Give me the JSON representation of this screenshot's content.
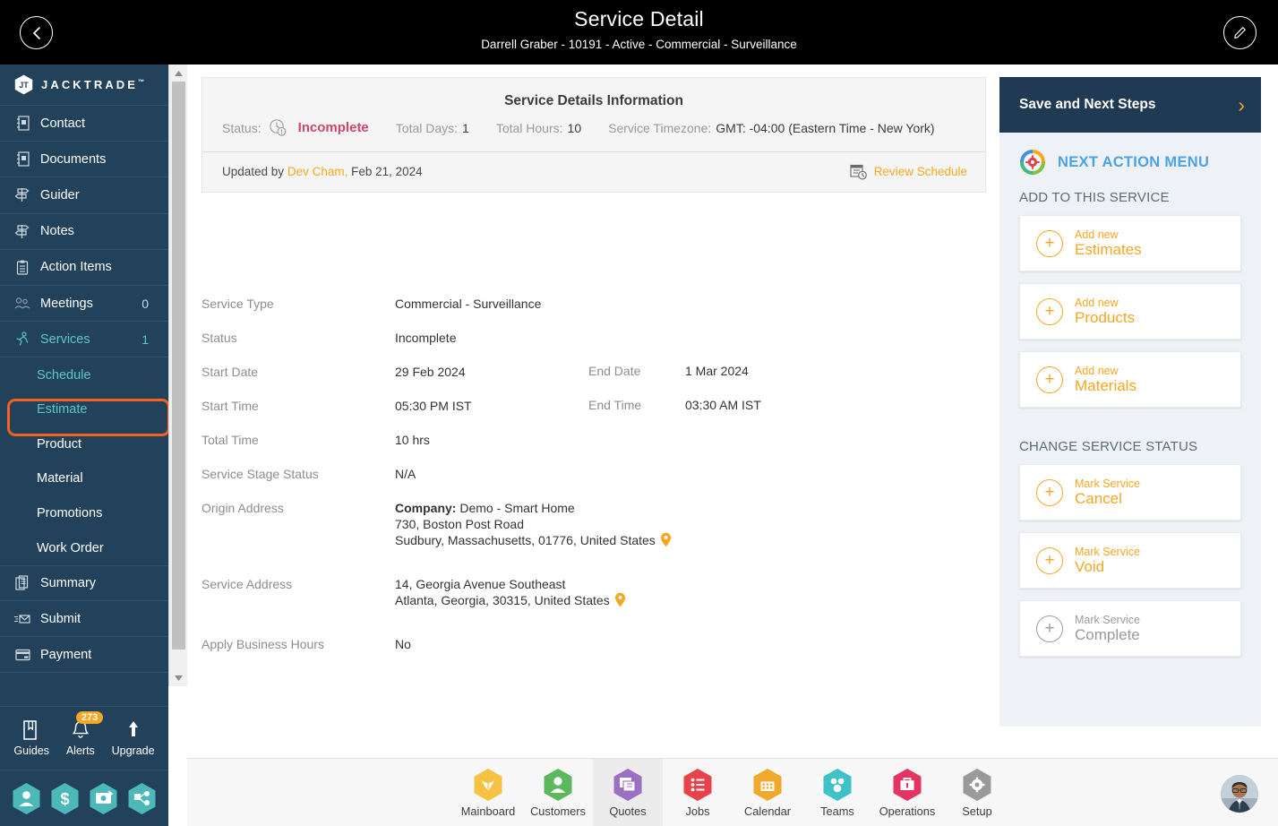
{
  "header": {
    "title": "Service Detail",
    "subtitle": "Darrell Graber - 10191 - Active - Commercial - Surveillance",
    "back_icon": "chevron-left-icon",
    "edit_icon": "pencil-icon"
  },
  "sidebar": {
    "brand": "JACKTRADE",
    "brand_tm": "™",
    "items": [
      {
        "label": "Contact",
        "icon": "contact-book-icon",
        "count": ""
      },
      {
        "label": "Documents",
        "icon": "documents-icon",
        "count": ""
      },
      {
        "label": "Guider",
        "icon": "guidepost-icon",
        "count": ""
      },
      {
        "label": "Notes",
        "icon": "guidepost-icon",
        "count": ""
      },
      {
        "label": "Action Items",
        "icon": "clipboard-icon",
        "count": ""
      },
      {
        "label": "Meetings",
        "icon": "meetings-icon",
        "count": "0"
      },
      {
        "label": "Services",
        "icon": "services-runner-icon",
        "count": "1"
      }
    ],
    "sub_items": [
      {
        "label": "Schedule",
        "state": "teal"
      },
      {
        "label": "Estimate",
        "state": "highlight"
      },
      {
        "label": "Product",
        "state": "normal"
      },
      {
        "label": "Material",
        "state": "normal"
      },
      {
        "label": "Promotions",
        "state": "normal"
      },
      {
        "label": "Work Order",
        "state": "normal"
      }
    ],
    "items_after": [
      {
        "label": "Summary",
        "icon": "summary-pages-icon",
        "count": ""
      },
      {
        "label": "Submit",
        "icon": "submit-envelope-icon",
        "count": ""
      },
      {
        "label": "Payment",
        "icon": "payment-card-icon",
        "count": ""
      }
    ],
    "bottom": [
      {
        "label": "Guides",
        "icon": "book-icon",
        "badge": ""
      },
      {
        "label": "Alerts",
        "icon": "bell-icon",
        "badge": "273"
      },
      {
        "label": "Upgrade",
        "icon": "up-arrow-icon",
        "badge": ""
      }
    ],
    "hex_buttons": [
      "user-hex-icon",
      "dollar-hex-icon",
      "money-transfer-hex-icon",
      "workflow-hex-icon"
    ],
    "highlight_color": "#f4621f"
  },
  "details_card": {
    "title": "Service Details Information",
    "status_label": "Status:",
    "status_icon": "clock-alert-icon",
    "status_value": "Incomplete",
    "total_days_label": "Total Days:",
    "total_days_value": "1",
    "total_hours_label": "Total Hours:",
    "total_hours_value": "10",
    "timezone_label": "Service Timezone:",
    "timezone_value": "GMT: -04:00 (Eastern Time - New York)",
    "updated_prefix": "Updated by",
    "updated_by": "Dev Cham,",
    "updated_date": "Feb 21, 2024",
    "review_schedule": "Review Schedule",
    "review_icon": "calendar-clock-icon"
  },
  "details": {
    "service_type_label": "Service Type",
    "service_type_value": "Commercial - Surveillance",
    "status_label": "Status",
    "status_value": "Incomplete",
    "start_date_label": "Start Date",
    "start_date_value": "29 Feb 2024",
    "end_date_label": "End Date",
    "end_date_value": "1 Mar 2024",
    "start_time_label": "Start Time",
    "start_time_value": "05:30 PM IST",
    "end_time_label": "End Time",
    "end_time_value": "03:30 AM IST",
    "total_time_label": "Total Time",
    "total_time_value": "10 hrs",
    "stage_status_label": "Service Stage Status",
    "stage_status_value": "N/A",
    "origin_address_label": "Origin Address",
    "origin_company_label": "Company:",
    "origin_company_value": "Demo - Smart Home",
    "origin_line2": "730, Boston Post Road",
    "origin_line3": "Sudbury, Massachusetts, 01776, United States",
    "service_address_label": "Service Address",
    "service_line1": "14, Georgia Avenue Southeast",
    "service_line2": "Atlanta, Georgia, 30315, United States",
    "business_hours_label": "Apply Business Hours",
    "business_hours_value": "No",
    "pin_icon": "map-pin-icon"
  },
  "right_panel": {
    "header_title": "Save and Next Steps",
    "header_chevron": "chevron-right-icon",
    "menu_icon": "refresh-gear-icon",
    "menu_title": "NEXT ACTION MENU",
    "section1_label": "ADD TO THIS SERVICE",
    "section1_items": [
      {
        "top": "Add new",
        "main": "Estimates",
        "muted": false
      },
      {
        "top": "Add new",
        "main": "Products",
        "muted": false
      },
      {
        "top": "Add new",
        "main": "Materials",
        "muted": false
      }
    ],
    "section2_label": "CHANGE SERVICE STATUS",
    "section2_items": [
      {
        "top": "Mark Service",
        "main": "Cancel",
        "muted": false
      },
      {
        "top": "Mark Service",
        "main": "Void",
        "muted": false
      },
      {
        "top": "Mark Service",
        "main": "Complete",
        "muted": true
      }
    ]
  },
  "bottom_nav": {
    "items": [
      {
        "label": "Mainboard",
        "icon": "mainboard-hex-icon",
        "color": "#f6c244",
        "selected": false
      },
      {
        "label": "Customers",
        "icon": "customers-hex-icon",
        "color": "#5cb85c",
        "selected": false
      },
      {
        "label": "Quotes",
        "icon": "quotes-hex-icon",
        "color": "#9b6fc4",
        "selected": true
      },
      {
        "label": "Jobs",
        "icon": "jobs-hex-icon",
        "color": "#e8434a",
        "selected": false
      },
      {
        "label": "Calendar",
        "icon": "calendar-hex-icon",
        "color": "#f2a92b",
        "selected": false
      },
      {
        "label": "Teams",
        "icon": "teams-hex-icon",
        "color": "#3ec1c9",
        "selected": false
      },
      {
        "label": "Operations",
        "icon": "operations-hex-icon",
        "color": "#e43562",
        "selected": false
      },
      {
        "label": "Setup",
        "icon": "setup-hex-icon",
        "color": "#9a9a9a",
        "selected": false
      }
    ],
    "avatar": "user-avatar"
  }
}
